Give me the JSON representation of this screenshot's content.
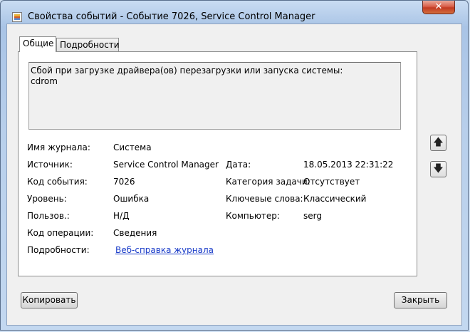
{
  "window": {
    "title": "Свойства событий - Событие 7026, Service Control Manager",
    "close_glyph": "✕"
  },
  "tabs": [
    {
      "label": "Общие",
      "active": true
    },
    {
      "label": "Подробности",
      "active": false
    }
  ],
  "description": {
    "lines": [
      "Сбой при загрузке драйвера(ов) перезагрузки или запуска системы:",
      "cdrom"
    ]
  },
  "fields": {
    "log_name": {
      "label": "Имя журнала:",
      "value": "Система"
    },
    "source": {
      "label": "Источник:",
      "value": "Service Control Manager"
    },
    "event_id": {
      "label": "Код события:",
      "value": "7026"
    },
    "level": {
      "label": "Уровень:",
      "value": "Ошибка"
    },
    "user": {
      "label": "Пользов.:",
      "value": "Н/Д"
    },
    "opcode": {
      "label": "Код операции:",
      "value": "Сведения"
    },
    "more_info": {
      "label": "Подробности:",
      "value": "Веб-справка журнала"
    },
    "date": {
      "label": "Дата:",
      "value": "18.05.2013 22:31:22"
    },
    "task_category": {
      "label": "Категория задачи:",
      "value": "Отсутствует"
    },
    "keywords": {
      "label": "Ключевые слова:",
      "value": "Классический"
    },
    "computer": {
      "label": "Компьютер:",
      "value": "serg"
    }
  },
  "nav": {
    "up_glyph": "🡅",
    "down_glyph": "🡇"
  },
  "buttons": {
    "copy": "Копировать",
    "close": "Закрыть"
  }
}
